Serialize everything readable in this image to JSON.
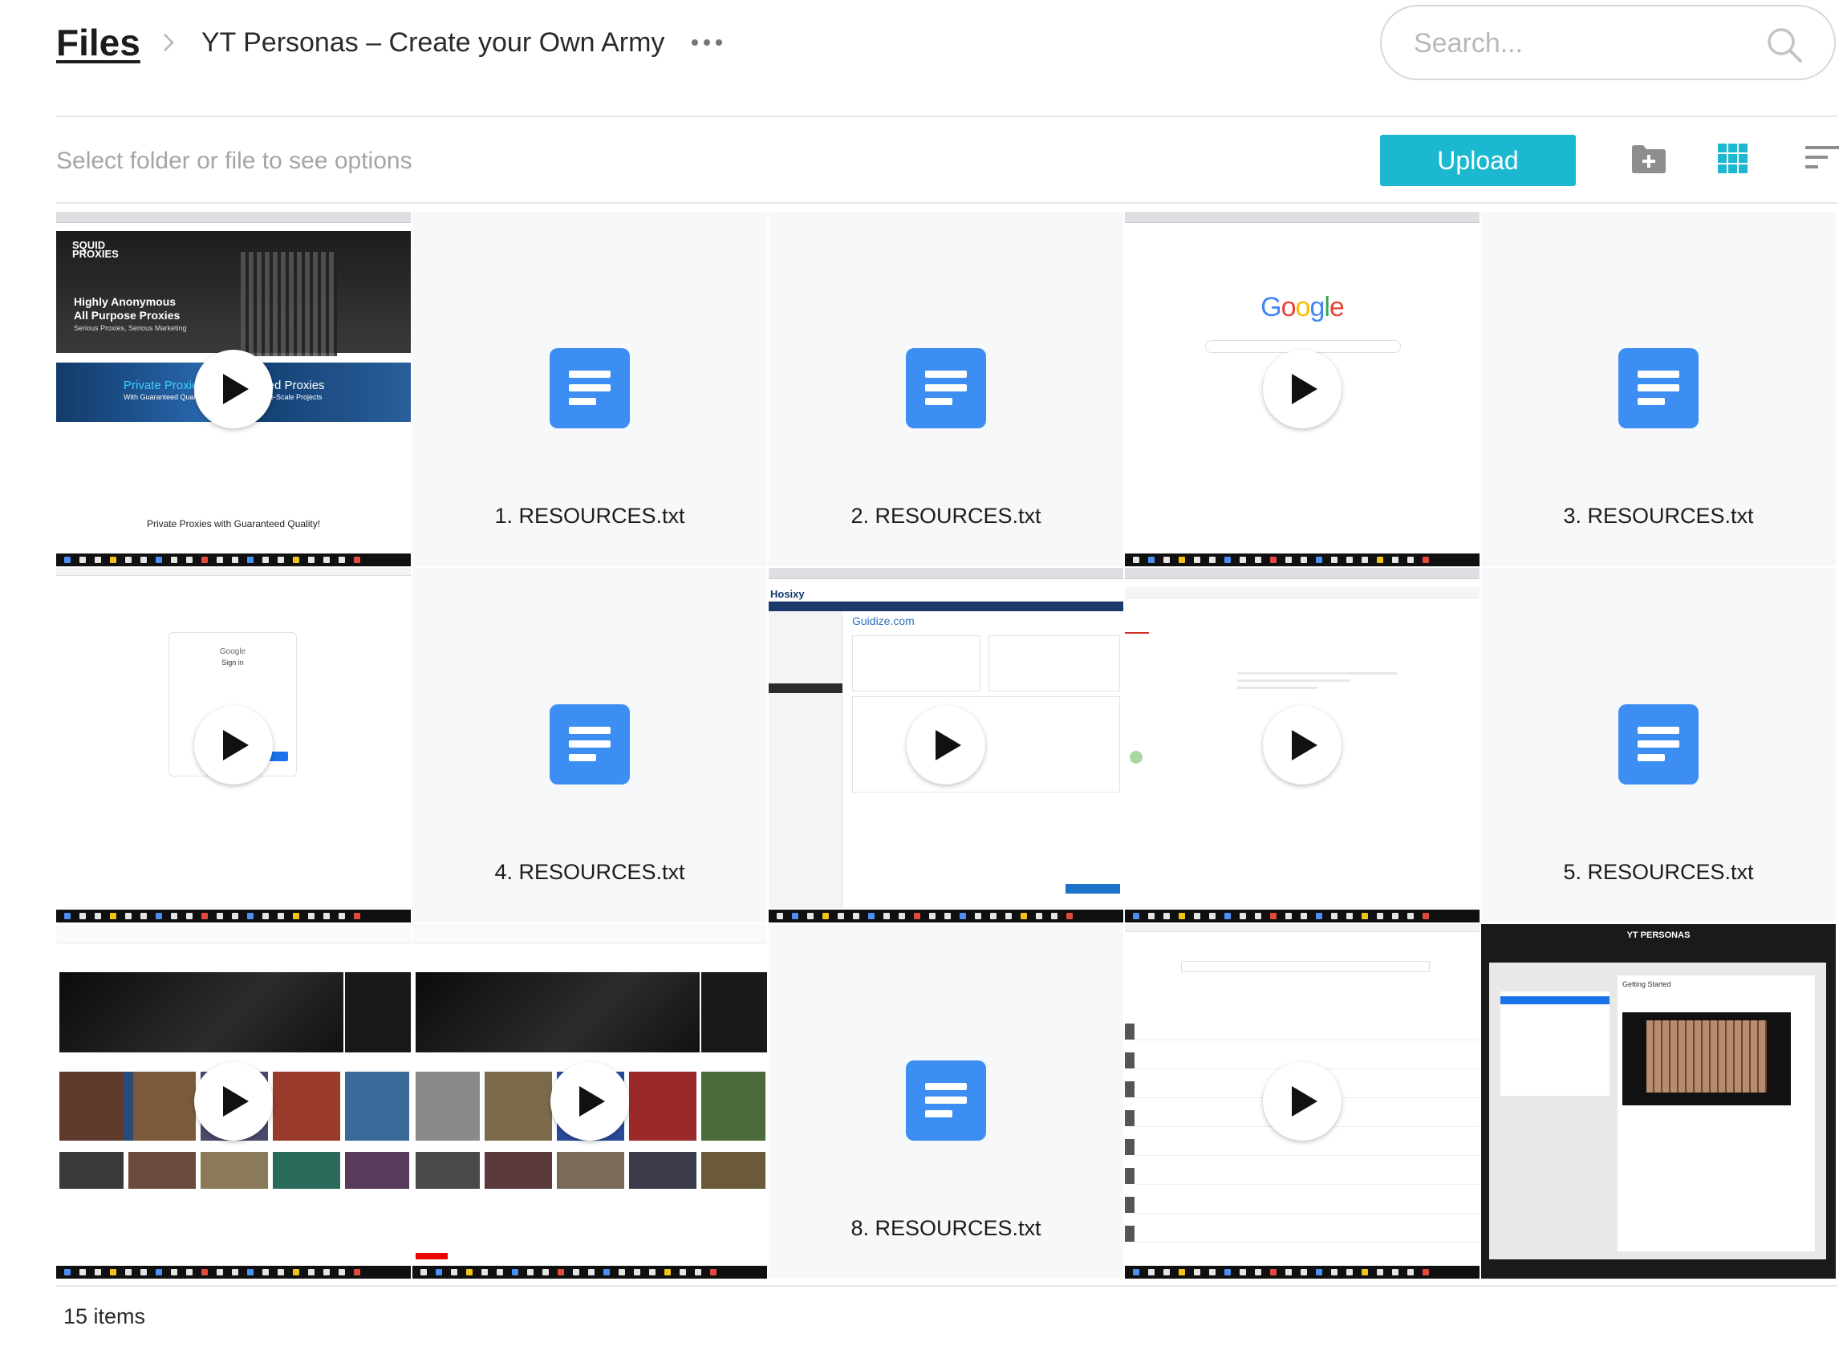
{
  "breadcrumb": {
    "root": "Files",
    "current": "YT Personas – Create your Own Army"
  },
  "search": {
    "placeholder": "Search..."
  },
  "toolbar": {
    "hint": "Select folder or file to see options",
    "upload_label": "Upload"
  },
  "icons": {
    "separator": "chevron-right-icon",
    "more": "more-horizontal-icon",
    "search": "search-icon",
    "new_folder": "folder-plus-icon",
    "grid_view": "grid-view-icon",
    "sort": "sort-lines-icon",
    "document": "document-icon",
    "play": "play-icon"
  },
  "colors": {
    "accent": "#1bb8d0",
    "doc_icon": "#3d8ef3",
    "grid_active": "#1bb8d0"
  },
  "tiles": [
    {
      "type": "video",
      "thumb": "squid-proxies",
      "title": "Highly Anonymous\nAll Purpose Proxies",
      "subtitle": "Serious Proxies, Serious Marketing",
      "promo_left": "Private Proxies",
      "promo_left_sub": "With Guaranteed Quality",
      "promo_right": "Shared Proxies",
      "promo_right_sub": "For Large-Scale Projects",
      "tagline": "Private Proxies with Guaranteed Quality!"
    },
    {
      "type": "doc",
      "name": "1. RESOURCES.txt"
    },
    {
      "type": "doc",
      "name": "2. RESOURCES.txt"
    },
    {
      "type": "video",
      "thumb": "google",
      "title": "Google"
    },
    {
      "type": "doc",
      "name": "3. RESOURCES.txt"
    },
    {
      "type": "video",
      "thumb": "google-signin",
      "title": "Google",
      "subtitle": "Sign in"
    },
    {
      "type": "doc",
      "name": "4. RESOURCES.txt"
    },
    {
      "type": "video",
      "thumb": "hosting",
      "title": "Hosixy",
      "subtitle": "Guidize.com"
    },
    {
      "type": "video",
      "thumb": "gmail",
      "title": ""
    },
    {
      "type": "doc",
      "name": "5. RESOURCES.txt"
    },
    {
      "type": "video",
      "thumb": "youtube-1",
      "title": ""
    },
    {
      "type": "video",
      "thumb": "youtube-2",
      "title": ""
    },
    {
      "type": "doc",
      "name": "8. RESOURCES.txt"
    },
    {
      "type": "video",
      "thumb": "youtube-studio",
      "title": ""
    },
    {
      "type": "image",
      "thumb": "yt-personas",
      "title": "YT PERSONAS",
      "subtitle": "Getting Started"
    }
  ],
  "footer": {
    "count": "15 items"
  }
}
